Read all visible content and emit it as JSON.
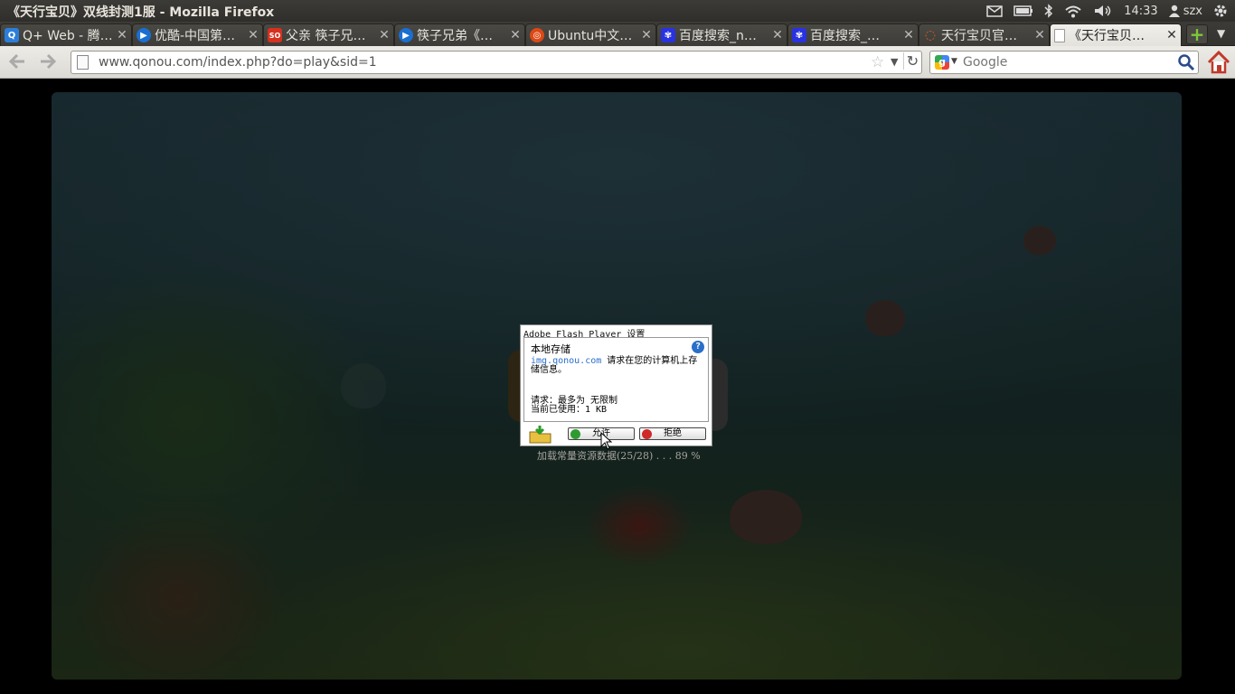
{
  "window": {
    "title": "《天行宝贝》双线封测1服 - Mozilla Firefox"
  },
  "indicators": {
    "time": "14:33",
    "user": "szx"
  },
  "tabs": [
    {
      "title": "Q+ Web - 腾…",
      "favicon": "qplus",
      "color": "#2b7fd9",
      "glyph": "Q"
    },
    {
      "title": "优酷-中国第…",
      "favicon": "youku",
      "color": "#1a6fd1",
      "glyph": "▶"
    },
    {
      "title": "父亲 筷子兄…",
      "favicon": "soku",
      "color": "#d7301f",
      "glyph": "SO"
    },
    {
      "title": "筷子兄弟《…",
      "favicon": "youku",
      "color": "#1a6fd1",
      "glyph": "▶"
    },
    {
      "title": "Ubuntu中文…",
      "favicon": "ubuntu",
      "color": "#dd4814",
      "glyph": "◎"
    },
    {
      "title": "百度搜索_n…",
      "favicon": "baidu",
      "color": "#2932e1",
      "glyph": "✾"
    },
    {
      "title": "百度搜索_…",
      "favicon": "baidu",
      "color": "#2932e1",
      "glyph": "✾"
    },
    {
      "title": "天行宝贝官…",
      "favicon": "loading",
      "color": "#e05a1e",
      "glyph": "◌"
    },
    {
      "title": "《天行宝贝…",
      "favicon": "page",
      "color": "#ffffff",
      "glyph": ""
    }
  ],
  "navbar": {
    "url": "www.qonou.com/index.php?do=play&sid=1",
    "search_placeholder": "Google"
  },
  "flash": {
    "title": "Adobe Flash Player 设置",
    "section": "本地存储",
    "domain": "img.qonou.com",
    "message": " 请求在您的计算机上存储信息。",
    "request_line": "请求：最多为 无限制",
    "usage_line": "当前已使用：1 KB",
    "allow_label": "允许",
    "deny_label": "拒绝"
  },
  "loading_text": "加载常量资源数据(25/28) . . . 89 %",
  "colors": {
    "accent": "#2a6fc9",
    "allow_icon": "#2e9b2e",
    "deny_icon": "#d02828"
  }
}
